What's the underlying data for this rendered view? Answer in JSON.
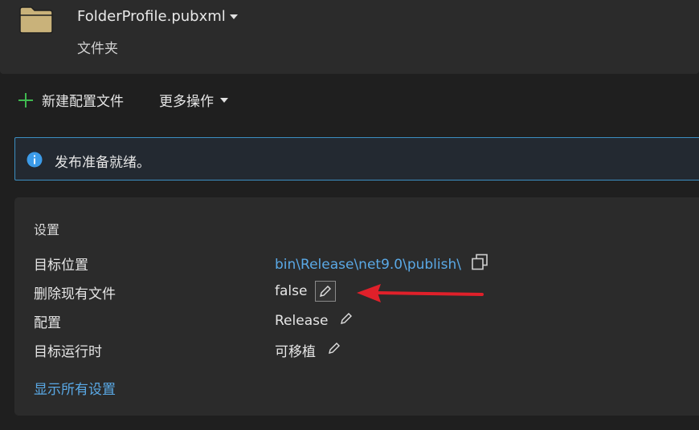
{
  "header": {
    "profile_name": "FolderProfile.pubxml",
    "profile_type": "文件夹"
  },
  "toolbar": {
    "new_profile_label": "新建配置文件",
    "more_actions_label": "更多操作"
  },
  "info": {
    "message": "发布准备就绪。"
  },
  "settings": {
    "title": "设置",
    "rows": [
      {
        "label": "目标位置",
        "value": "bin\\Release\\net9.0\\publish\\"
      },
      {
        "label": "删除现有文件",
        "value": "false"
      },
      {
        "label": "配置",
        "value": "Release"
      },
      {
        "label": "目标运行时",
        "value": "可移植"
      }
    ],
    "show_all_label": "显示所有设置"
  },
  "colors": {
    "accent_link": "#5aa9e6",
    "info_border": "#3c8fc2",
    "plus_green": "#3fb950",
    "annotation_arrow": "#e0202a"
  }
}
